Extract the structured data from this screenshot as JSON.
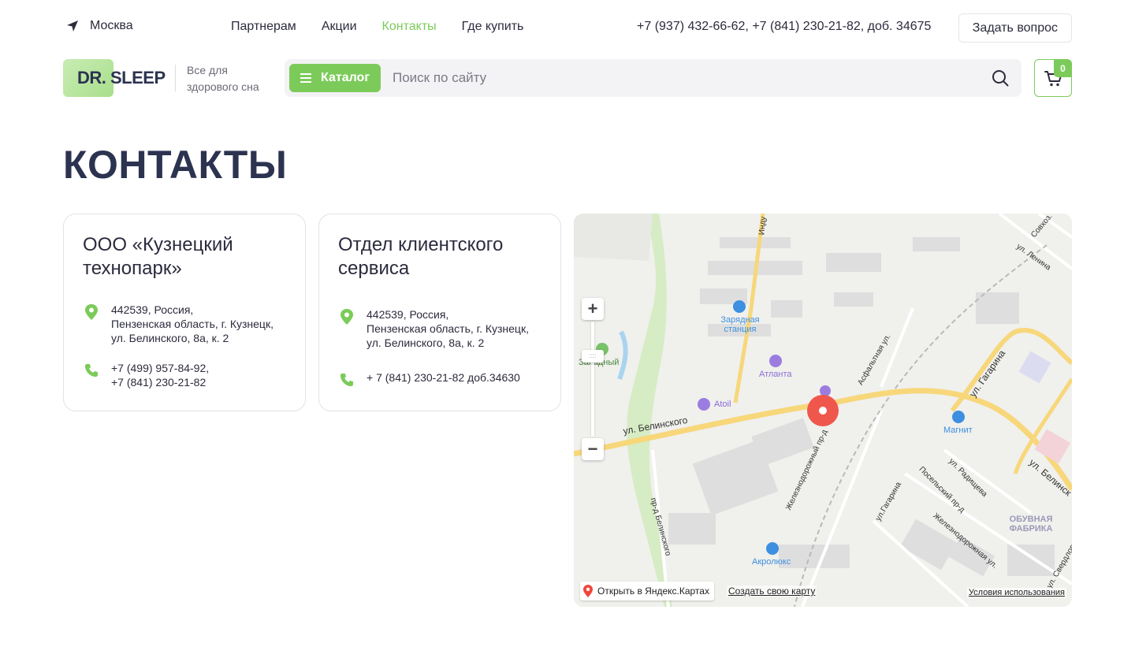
{
  "topbar": {
    "city": "Москва",
    "nav": [
      {
        "label": "Партнерам",
        "active": false
      },
      {
        "label": "Акции",
        "active": false
      },
      {
        "label": "Контакты",
        "active": true
      },
      {
        "label": "Где купить",
        "active": false
      }
    ],
    "phones": "+7 (937) 432-66-62, +7 (841) 230-21-82, доб. 34675",
    "ask_label": "Задать вопрос"
  },
  "header": {
    "logo_text": "DR. SLEEP",
    "tagline": "Все для здорового сна",
    "catalog_label": "Каталог",
    "search_placeholder": "Поиск по сайту",
    "cart_count": "0"
  },
  "page": {
    "title": "КОНТАКТЫ"
  },
  "cards": [
    {
      "title": "ООО «Кузнецкий технопарк»",
      "address": [
        "442539, Россия,",
        "Пензенская область, г. Кузнецк,",
        "ул. Белинского, 8а, к. 2"
      ],
      "phones": [
        "+7 (499) 957-84-92,",
        "+7 (841) 230-21-82"
      ]
    },
    {
      "title": "Отдел клиентского сервиса",
      "address": [
        "442539, Россия,",
        "Пензенская область, г. Кузнецк,",
        "ул. Белинского, 8а, к. 2"
      ],
      "phones": [
        "+ 7 (841) 230-21-82 доб.34630"
      ]
    }
  ],
  "map": {
    "open_label": "Открыть в Яндекс.Картах",
    "create_label": "Создать свою карту",
    "terms_label": "Условия использования",
    "streets": {
      "belinskogo": "ул. Белинского",
      "belinskogo2": "ул. Белинск",
      "gagarina": "ул. Гагарина",
      "gagarina2": "ул.Гагарина",
      "asphalt": "Асфальтная ул.",
      "zhd": "Железнодорожный пр-д",
      "zhd2": "Железнодорожная ул.",
      "posel": "Посельский пр-д",
      "radish": "ул. Радищева",
      "prbel": "пр-д Белинского",
      "lenina": "ул. Ленина",
      "sovkh": "Совхоз.",
      "industr": "Инду",
      "sverdl": "ул. Свердлова"
    },
    "pois": {
      "charging": "Зарядная станция",
      "atlanta": "Атланта",
      "atoil": "Atoil",
      "magnit": "Магнит",
      "akrolux": "Акролюкс",
      "zapadny": "Западный",
      "factory": "ОБУВНАЯ ФАБРИКА"
    }
  },
  "colors": {
    "accent": "#7ccb5a",
    "text": "#2b2b3d",
    "marker": "#f0574c"
  }
}
